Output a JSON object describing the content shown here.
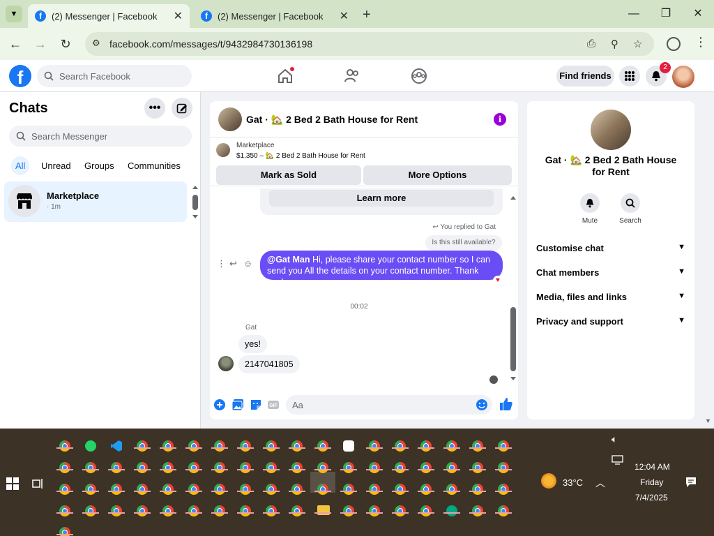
{
  "browser": {
    "tabs": [
      {
        "title": "(2) Messenger | Facebook",
        "active": true
      },
      {
        "title": "(2) Messenger | Facebook",
        "active": false
      }
    ],
    "url": "facebook.com/messages/t/9432984730136198"
  },
  "fb_nav": {
    "search_placeholder": "Search Facebook",
    "find_friends": "Find friends",
    "notification_count": "2"
  },
  "sidebar": {
    "title": "Chats",
    "search_placeholder": "Search Messenger",
    "filters": [
      "All",
      "Unread",
      "Groups",
      "Communities"
    ],
    "active_filter": "All",
    "chats": [
      {
        "name": "Marketplace",
        "time": "· 1m"
      }
    ]
  },
  "conversation": {
    "title": "Gat · 🏡 2 Bed 2 Bath House for Rent",
    "marketplace_label": "Marketplace",
    "listing": "$1,350 – 🏡 2 Bed 2 Bath House for Rent",
    "mark_sold": "Mark as Sold",
    "more_options": "More Options",
    "learn_more": "Learn more",
    "replied_note": "You replied to Gat",
    "quoted_message": "Is this still available?",
    "outgoing_mention": "@Gat Man",
    "outgoing_text": "Hi, please share your contact number so I can send you All the details on your contact number. Thank you!",
    "time_separator": "00:02",
    "sender_name": "Gat",
    "incoming": [
      "yes!",
      "2147041805"
    ],
    "composer_placeholder": "Aa"
  },
  "right_panel": {
    "title": "Gat · 🏡 2 Bed 2 Bath House for Rent",
    "actions": [
      "Mute",
      "Search"
    ],
    "sections": [
      "Customise chat",
      "Chat members",
      "Media, files and links",
      "Privacy and support"
    ]
  },
  "taskbar": {
    "weather": "33°C",
    "time": "12:04 AM",
    "day": "Friday",
    "date": "7/4/2025"
  },
  "colors": {
    "fb_blue": "#1877f2",
    "outgoing_bubble": "#6b4df6",
    "chrome_tabbar": "#d3e3c8",
    "taskbar": "#3d3226"
  }
}
